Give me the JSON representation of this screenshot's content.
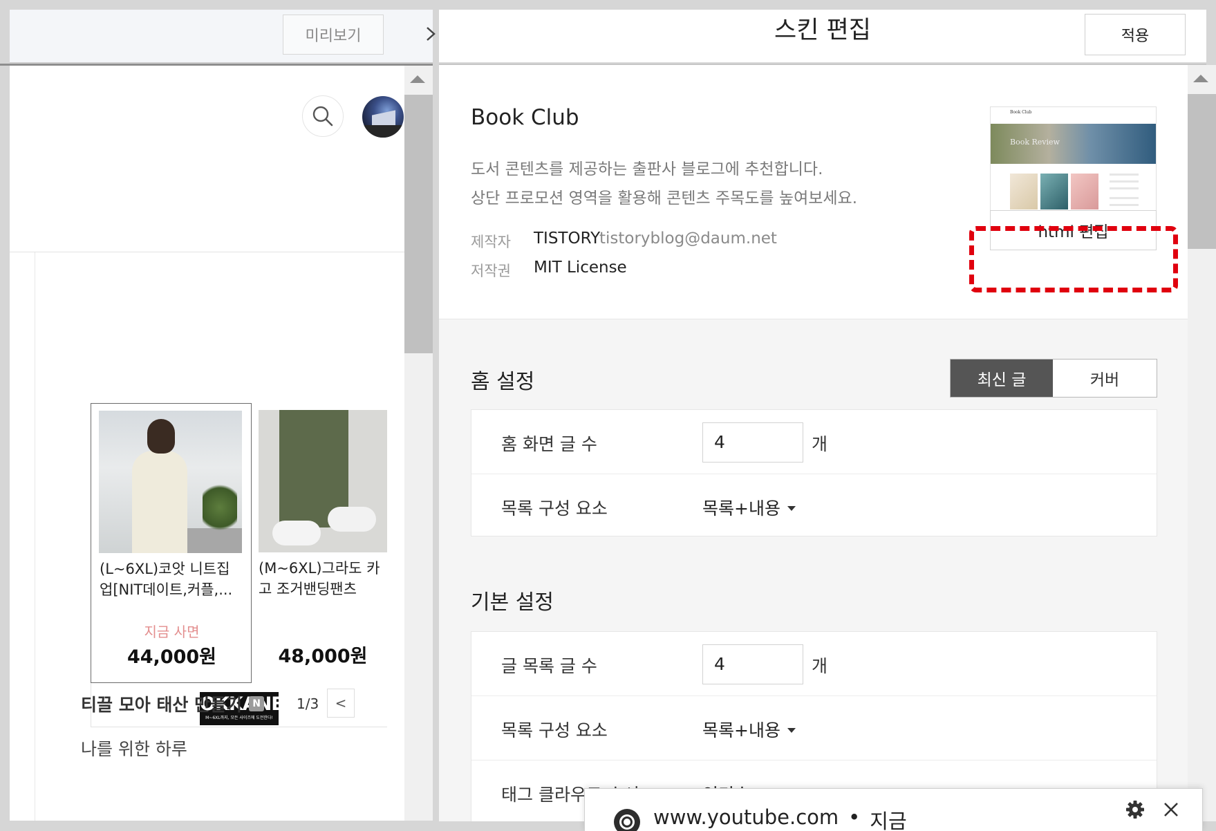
{
  "preview": {
    "preview_button": "미리보기",
    "ad": {
      "items": [
        {
          "title_line1": "(L~6XL)코앗 니트집",
          "title_line2": "업[NIT데이트,커플,...",
          "subtitle": "지금 사면",
          "price": "44,000원"
        },
        {
          "title_line1": "(M~6XL)그라도 카",
          "title_line2": "고 조거밴딩팬츠",
          "price": "48,000원"
        }
      ],
      "brand_logo": "OKKANE",
      "brand_tagline": "M~6XL까지, 모든 사이즈에 도전한다!",
      "pager": "1/3",
      "prev_symbol": "<"
    },
    "post_title": "티끌 모아 태산 만들기",
    "new_badge": "N",
    "post_subtitle": "나를 위한 하루"
  },
  "editor": {
    "title": "스킨 편집",
    "apply_button": "적용",
    "skin": {
      "name": "Book Club",
      "description_line1": "도서 콘텐츠를 제공하는 출판사 블로그에 추천합니다.",
      "description_line2": "상단 프로모션 영역을 활용해 콘텐츠 주목도를 높여보세요.",
      "author_label": "제작자",
      "author_name": "TISTORY",
      "author_email": "tistoryblog@daum.net",
      "license_label": "저작권",
      "license_value": "MIT License",
      "thumbnail_hero_text": "Book Review",
      "thumbnail_bar_text": "Book Club",
      "html_edit_button": "html 편집"
    },
    "home_settings": {
      "title": "홈 설정",
      "toggle_options": [
        "최신 글",
        "커버"
      ],
      "selected_toggle": "최신 글",
      "post_count_label": "홈 화면 글 수",
      "post_count_value": "4",
      "post_count_unit": "개",
      "list_elements_label": "목록 구성 요소",
      "list_elements_value": "목록+내용"
    },
    "basic_settings": {
      "title": "기본 설정",
      "list_count_label": "글 목록 글 수",
      "list_count_value": "4",
      "list_count_unit": "개",
      "list_elements_label": "목록 구성 요소",
      "list_elements_value": "목록+내용",
      "tag_cloud_label": "태그 클라우드 순서",
      "tag_cloud_value": "인기순"
    }
  },
  "notification": {
    "source": "www.youtube.com",
    "separator": "•",
    "time": "지금"
  },
  "colors": {
    "highlight": "#e0000e",
    "toggle_active_bg": "#555555",
    "promo_text": "#e38e8e"
  }
}
